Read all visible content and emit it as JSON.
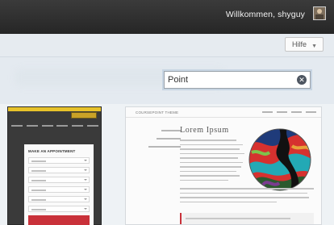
{
  "topbar": {
    "welcome_text": "Willkommen, shyguy"
  },
  "header": {
    "help_label": "Hilfe",
    "help_caret": "▼"
  },
  "search": {
    "value": "Point",
    "clear_glyph": "✕"
  },
  "thumbnails": [
    {
      "kind": "phone-preview",
      "form_title": "MAKE AN APPOINTMENT",
      "fields": 6,
      "accent_color": "#c9313a",
      "brand_strip_color": "#e7c22a"
    },
    {
      "kind": "webpage-preview",
      "theme_name": "COURSEPOINT THEME",
      "heading": "Lorem Ipsum",
      "accent_color": "#c9313a"
    }
  ],
  "colors": {
    "topbar": "#2f2f2f",
    "page_background": "#e9eef3",
    "search_focus_ring": "#c7d5e3"
  }
}
